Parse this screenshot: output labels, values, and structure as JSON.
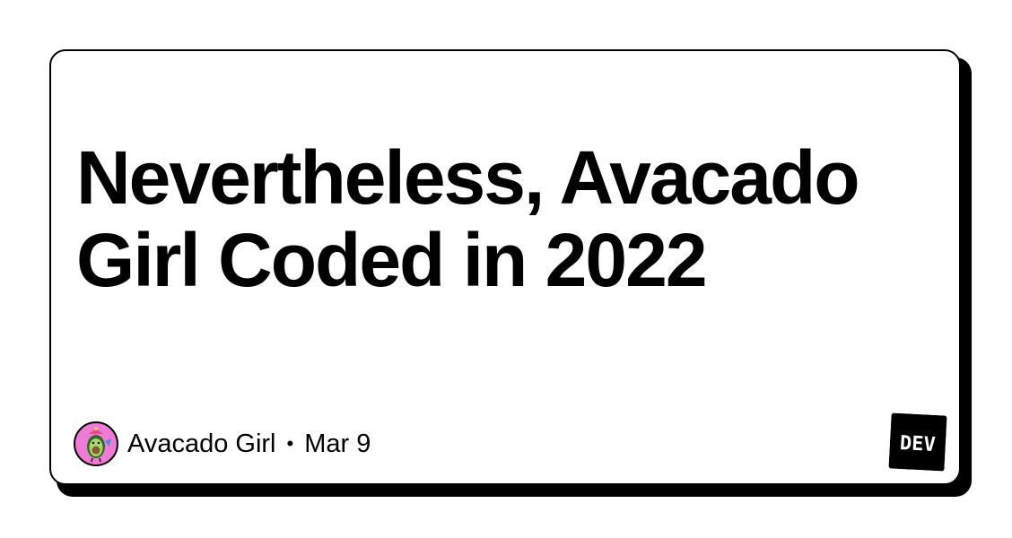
{
  "card": {
    "title": "Nevertheless, Avacado Girl Coded in 2022"
  },
  "meta": {
    "author": "Avacado Girl",
    "separator": "•",
    "date": "Mar 9"
  },
  "logo": {
    "text": "DEV"
  },
  "colors": {
    "background": "#ffffff",
    "ink": "#000000",
    "avatar_bg": "#f07ad8",
    "avocado_green": "#7cbf3f",
    "avocado_pit": "#8a5a2b"
  },
  "icons": {
    "avatar": "avocado-avatar-icon",
    "logo": "dev-logo-icon"
  }
}
